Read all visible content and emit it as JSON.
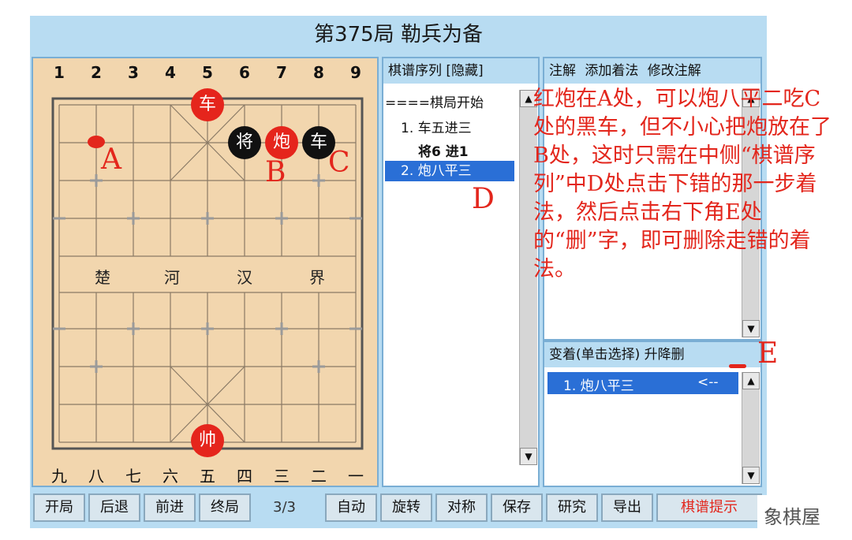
{
  "title": "第375局  勒兵为备",
  "board": {
    "top_files": [
      "1",
      "2",
      "3",
      "4",
      "5",
      "6",
      "7",
      "8",
      "9"
    ],
    "bottom_files": [
      "九",
      "八",
      "七",
      "六",
      "五",
      "四",
      "三",
      "二",
      "一"
    ],
    "river": [
      "楚",
      "河",
      "汉",
      "界"
    ],
    "pieces": [
      {
        "label": "车",
        "color": "red"
      },
      {
        "label": "将",
        "color": "black"
      },
      {
        "label": "炮",
        "color": "red"
      },
      {
        "label": "车",
        "color": "black"
      },
      {
        "label": "帅",
        "color": "red"
      }
    ]
  },
  "moves": {
    "header": "棋谱序列  [隐藏]",
    "items": [
      "====棋局开始",
      "1. 车五进三",
      "将6 进1",
      "2. 炮八平三"
    ],
    "selected_index": 3
  },
  "notes": {
    "header": "注解 添加着法 修改注解"
  },
  "variations": {
    "header": "变着(单击选择)  升降删",
    "items": [
      "1. 炮八平三",
      "<--"
    ]
  },
  "toolbar": {
    "buttons": [
      "开局",
      "后退",
      "前进",
      "终局",
      "自动",
      "旋转",
      "对称",
      "保存",
      "研究",
      "导出",
      "棋谱提示"
    ],
    "page": "3/3"
  },
  "annotations": {
    "A": "A",
    "B": "B",
    "C": "C",
    "D": "D",
    "E": "E",
    "explain": "红炮在A处，可以炮八平二吃C处的黑车，但不小心把炮放在了B处，这时只需在中侧“棋谱序列”中D处点击下错的那一步着法，然后点击右下角E处的“删”字，即可删除走错的着法。"
  },
  "watermark": "象棋屋",
  "colors": {
    "board": "#f2d6ae",
    "frame": "#b8dcf2",
    "red_piece": "#e5251c",
    "annotation": "#e3261c",
    "selection": "#2a6fd6"
  }
}
